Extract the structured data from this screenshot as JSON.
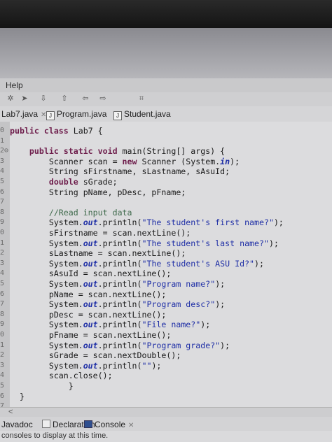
{
  "menu": {
    "help": "Help"
  },
  "tabs": [
    {
      "label": "Lab7.java",
      "close": "✕"
    },
    {
      "label": "Program.java"
    },
    {
      "label": "Student.java"
    }
  ],
  "editor": {
    "line_numbers": [
      "0",
      "1",
      "2⊖",
      "3",
      "4",
      "5",
      "6",
      "7",
      "8",
      "9",
      "0",
      "1",
      "2",
      "3",
      "4",
      "5",
      "6",
      "7",
      "8",
      "9",
      "0",
      "1",
      "2",
      "3",
      "4",
      "5",
      "6",
      "7"
    ],
    "lines": [
      [
        [
          "kw",
          "public class "
        ],
        [
          "",
          "Lab7 {"
        ]
      ],
      [
        [
          "",
          ""
        ]
      ],
      [
        [
          "",
          "    "
        ],
        [
          "kw",
          "public static void "
        ],
        [
          "",
          "main(String[] args) {"
        ]
      ],
      [
        [
          "",
          "        Scanner scan = "
        ],
        [
          "kw",
          "new "
        ],
        [
          "",
          "Scanner (System."
        ],
        [
          "fld",
          "in"
        ],
        [
          "",
          ");"
        ]
      ],
      [
        [
          "",
          "        String sFirstname, sLastname, sAsuId;"
        ]
      ],
      [
        [
          "",
          "        "
        ],
        [
          "kw",
          "double "
        ],
        [
          "",
          "sGrade;"
        ]
      ],
      [
        [
          "",
          "        String pName, pDesc, pFname;"
        ]
      ],
      [
        [
          "",
          ""
        ]
      ],
      [
        [
          "",
          "        "
        ],
        [
          "cmt",
          "//Read input data"
        ]
      ],
      [
        [
          "",
          "        System."
        ],
        [
          "fld",
          "out"
        ],
        [
          "",
          ".println("
        ],
        [
          "str",
          "\"The student's first name?\""
        ],
        [
          "",
          ");"
        ]
      ],
      [
        [
          "",
          "        sFirstname = scan.nextLine();"
        ]
      ],
      [
        [
          "",
          "        System."
        ],
        [
          "fld",
          "out"
        ],
        [
          "",
          ".println("
        ],
        [
          "str",
          "\"The student's last name?\""
        ],
        [
          "",
          ");"
        ]
      ],
      [
        [
          "",
          "        sLastname = scan.nextLine();"
        ]
      ],
      [
        [
          "",
          "        System."
        ],
        [
          "fld",
          "out"
        ],
        [
          "",
          ".println("
        ],
        [
          "str",
          "\"The student's ASU Id?\""
        ],
        [
          "",
          ");"
        ]
      ],
      [
        [
          "",
          "        sAsuId = scan.nextLine();"
        ]
      ],
      [
        [
          "",
          "        System."
        ],
        [
          "fld",
          "out"
        ],
        [
          "",
          ".println("
        ],
        [
          "str",
          "\"Program name?\""
        ],
        [
          "",
          ");"
        ]
      ],
      [
        [
          "",
          "        pName = scan.nextLine();"
        ]
      ],
      [
        [
          "",
          "        System."
        ],
        [
          "fld",
          "out"
        ],
        [
          "",
          ".println("
        ],
        [
          "str",
          "\"Program desc?\""
        ],
        [
          "",
          ");"
        ]
      ],
      [
        [
          "",
          "        pDesc = scan.nextLine();"
        ]
      ],
      [
        [
          "",
          "        System."
        ],
        [
          "fld",
          "out"
        ],
        [
          "",
          ".println("
        ],
        [
          "str",
          "\"File name?\""
        ],
        [
          "",
          ");"
        ]
      ],
      [
        [
          "",
          "        pFname = scan.nextLine();"
        ]
      ],
      [
        [
          "",
          "        System."
        ],
        [
          "fld",
          "out"
        ],
        [
          "",
          ".println("
        ],
        [
          "str",
          "\"Program grade?\""
        ],
        [
          "",
          ");"
        ]
      ],
      [
        [
          "",
          "        sGrade = scan.nextDouble();"
        ]
      ],
      [
        [
          "",
          "        System."
        ],
        [
          "fld",
          "out"
        ],
        [
          "",
          ".println("
        ],
        [
          "str",
          "\"\""
        ],
        [
          "",
          ");"
        ]
      ],
      [
        [
          "",
          "        scan.close();"
        ]
      ],
      [
        [
          "",
          "            }"
        ]
      ],
      [
        [
          "",
          "  }"
        ]
      ],
      [
        [
          "",
          ""
        ]
      ]
    ]
  },
  "bottom_tabs": [
    {
      "label": "Javadoc"
    },
    {
      "label": "Declaration"
    },
    {
      "label": "Console",
      "close": "✕"
    }
  ],
  "console": {
    "message": "consoles to display at this time."
  },
  "scroll": {
    "left_arrow": "<"
  }
}
